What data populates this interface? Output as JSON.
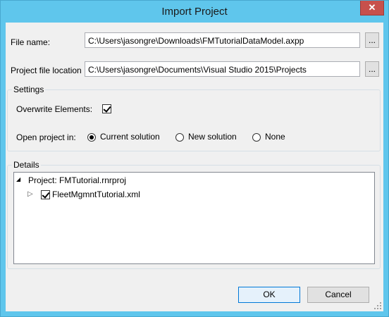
{
  "window": {
    "title": "Import Project",
    "close_symbol": "✕"
  },
  "file_name": {
    "label": "File name:",
    "value": "C:\\Users\\jasongre\\Downloads\\FMTutorialDataModel.axpp",
    "browse_label": "..."
  },
  "project_location": {
    "label": "Project file location",
    "value": "C:\\Users\\jasongre\\Documents\\Visual Studio 2015\\Projects",
    "browse_label": "..."
  },
  "settings": {
    "title": "Settings",
    "overwrite_label": "Overwrite Elements:",
    "overwrite_checked": true,
    "open_in_label": "Open project in:",
    "options": [
      "Current solution",
      "New solution",
      "None"
    ],
    "selected": "Current solution"
  },
  "details": {
    "title": "Details",
    "project_node": "Project: FMTutorial.rnrproj",
    "project_expander": "◢",
    "file_node": "FleetMgmntTutorial.xml",
    "file_expander": "▷",
    "file_checked": true
  },
  "buttons": {
    "ok": "OK",
    "cancel": "Cancel"
  }
}
